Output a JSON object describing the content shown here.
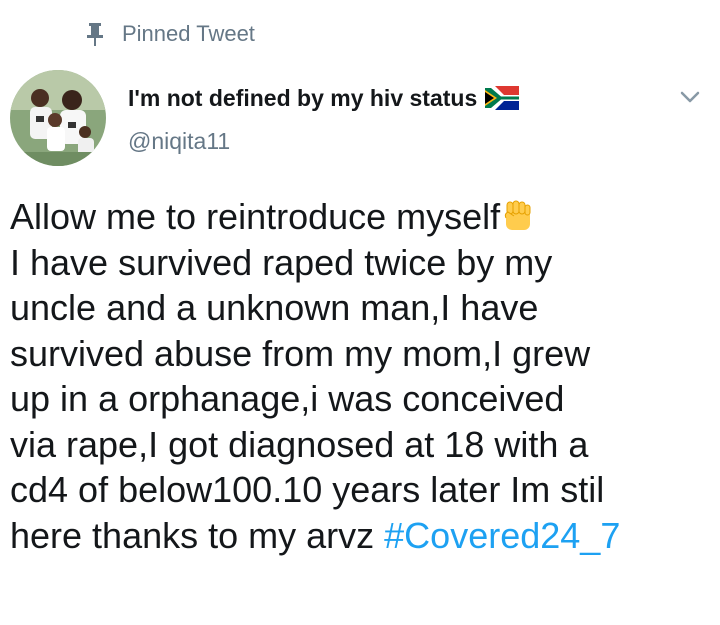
{
  "pinned": {
    "label": "Pinned Tweet",
    "icon": "pin-icon"
  },
  "author": {
    "name": "I'm not defined by my hiv status",
    "handle": "@niqita11",
    "flag_icon": "south-africa-flag-icon",
    "avatar_icon": "profile-avatar"
  },
  "menu": {
    "icon": "chevron-down-icon"
  },
  "tweet": {
    "line_1": "Allow me to reintroduce myself",
    "emoji": "raised-fist-emoji",
    "body": "I have survived raped twice by my\nuncle and a unknown man,I have\nsurvived abuse from my mom,I grew\nup in a orphanage,i was conceived\nvia rape,I got diagnosed at 18 with a\ncd4 of below100.10 years later Im stil\nhere thanks to my arvz ",
    "hashtag": "#Covered24_7"
  },
  "colors": {
    "text": "#14171a",
    "secondary": "#657786",
    "link": "#1da1f2"
  }
}
